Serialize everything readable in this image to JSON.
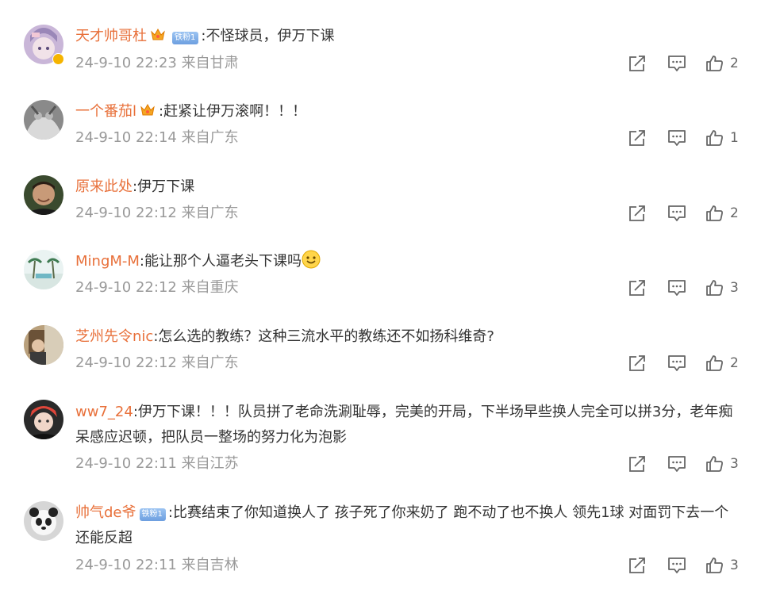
{
  "comments": [
    {
      "name": "天才帅哥杜",
      "badge": "铁粉1",
      "text": ":不怪球员，伊万下课",
      "time": "24-9-10 22:23",
      "loc": "来自甘肃",
      "likes": "2"
    },
    {
      "name": "一个番茄l",
      "text": ":赶紧让伊万滚啊！！！",
      "time": "24-9-10 22:14",
      "loc": "来自广东",
      "likes": "1"
    },
    {
      "name": "原来此处",
      "text": ":伊万下课",
      "time": "24-9-10 22:12",
      "loc": "来自广东",
      "likes": "2"
    },
    {
      "name": "MingM-M",
      "text": ":能让那个人逼老头下课吗",
      "time": "24-9-10 22:12",
      "loc": "来自重庆",
      "likes": "3"
    },
    {
      "name": "芝州先令nic",
      "text": ":怎么选的教练？这种三流水平的教练还不如扬科维奇?",
      "time": "24-9-10 22:12",
      "loc": "来自广东",
      "likes": "2"
    },
    {
      "name": "ww7_24",
      "text": ":伊万下课！！！队员拼了老命洗涮耻辱，完美的开局，下半场早些换人完全可以拼3分，老年痴呆感应迟顿，把队员一整场的努力化为泡影",
      "time": "24-9-10 22:11",
      "loc": "来自江苏",
      "likes": "3"
    },
    {
      "name": "帅气de爷",
      "badge": "铁粉1",
      "text": ":比赛结束了你知道换人了 孩子死了你来奶了 跑不动了也不换人 领先1球 对面罚下去一个 还能反超",
      "time": "24-9-10 22:11",
      "loc": "来自吉林",
      "likes": "3"
    }
  ],
  "icons": {
    "share": "share-icon",
    "reply": "comment-icon",
    "like": "thumb-up-icon",
    "crown": "crown-icon",
    "emoji": "smile-emoji-icon",
    "verified": "verified-badge-icon"
  },
  "colors": {
    "username": "#e8703a",
    "meta": "#999999",
    "badge": "#6d9fe0"
  }
}
